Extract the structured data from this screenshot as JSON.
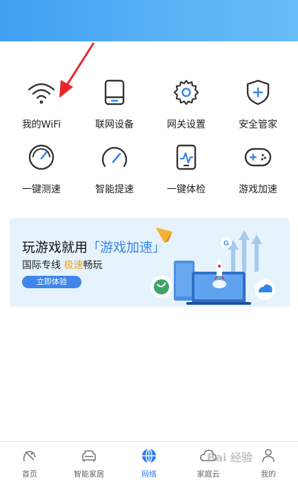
{
  "colors": {
    "header": "#4aa8f4",
    "accent": "#2f7de8",
    "banner_bg": "#e6f2fc"
  },
  "grid": {
    "items": [
      {
        "label": "我的WiFi",
        "icon": "wifi-icon"
      },
      {
        "label": "联网设备",
        "icon": "device-icon"
      },
      {
        "label": "网关设置",
        "icon": "gear-icon"
      },
      {
        "label": "安全管家",
        "icon": "shield-plus-icon"
      },
      {
        "label": "一键测速",
        "icon": "speedometer-icon"
      },
      {
        "label": "智能提速",
        "icon": "speed-boost-icon"
      },
      {
        "label": "一键体检",
        "icon": "health-check-icon"
      },
      {
        "label": "游戏加速",
        "icon": "gamepad-icon"
      }
    ]
  },
  "banner": {
    "title_main": "玩游戏就用",
    "title_highlight": "游戏加速",
    "bracket_open": "「",
    "bracket_close": "」",
    "sub_a": "国际专线 ",
    "sub_fast": "极速",
    "sub_b": "畅玩",
    "button": "立即体验"
  },
  "tabs": [
    {
      "label": "首页",
      "icon": "home-satellite-icon"
    },
    {
      "label": "智能家居",
      "icon": "sofa-icon"
    },
    {
      "label": "网络",
      "icon": "globe-icon",
      "active": true
    },
    {
      "label": "家庭云",
      "icon": "cloud-icon"
    },
    {
      "label": "我的",
      "icon": "person-icon"
    }
  ],
  "watermark": "Bai 经验"
}
